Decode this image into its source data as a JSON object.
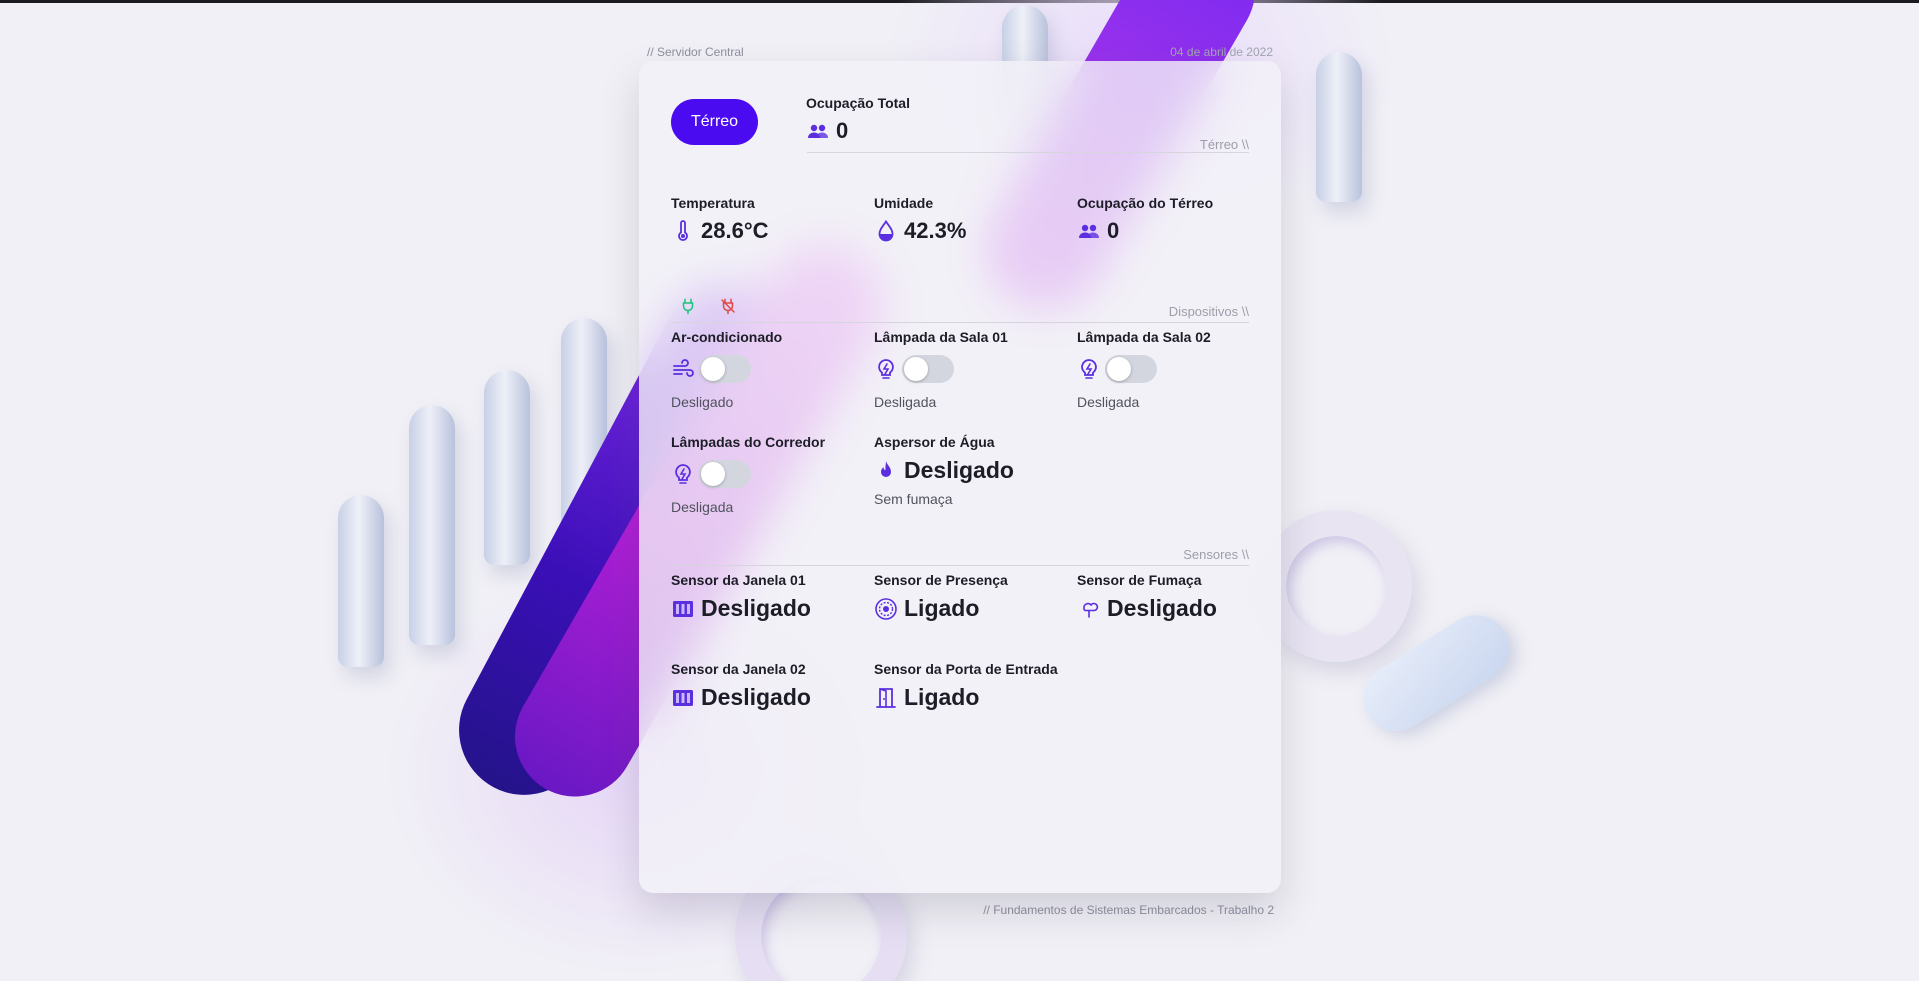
{
  "page": {
    "header_left": "// Servidor Central",
    "header_right": "04 de abril de 2022",
    "footer": "// Fundamentos de Sistemas Embarcados - Trabalho 2"
  },
  "floor": {
    "button_label": "Térreo",
    "total_occupancy_label": "Ocupação Total",
    "total_occupancy_value": "0",
    "section_label": "Térreo \\\\"
  },
  "climate": {
    "temperature_label": "Temperatura",
    "temperature_value": "28.6°C",
    "humidity_label": "Umidade",
    "humidity_value": "42.3%",
    "floor_occupancy_label": "Ocupação do Térreo",
    "floor_occupancy_value": "0"
  },
  "devices": {
    "section_label": "Dispositivos \\\\",
    "items": [
      {
        "label": "Ar-condicionado",
        "state": "Desligado",
        "on": false,
        "icon": "wind-icon"
      },
      {
        "label": "Lâmpada da Sala 01",
        "state": "Desligada",
        "on": false,
        "icon": "lightbulb-icon"
      },
      {
        "label": "Lâmpada da Sala 02",
        "state": "Desligada",
        "on": false,
        "icon": "lightbulb-icon"
      },
      {
        "label": "Lâmpadas do Corredor",
        "state": "Desligada",
        "on": false,
        "icon": "lightbulb-icon"
      }
    ],
    "sprinkler": {
      "label": "Aspersor de Água",
      "value": "Desligado",
      "sub": "Sem fumaça",
      "icon": "flame-icon"
    }
  },
  "sensors": {
    "section_label": "Sensores \\\\",
    "items": [
      {
        "label": "Sensor da Janela 01",
        "value": "Desligado",
        "icon": "window-icon"
      },
      {
        "label": "Sensor de Presença",
        "value": "Ligado",
        "icon": "presence-icon"
      },
      {
        "label": "Sensor de Fumaça",
        "value": "Desligado",
        "icon": "smoke-icon"
      },
      {
        "label": "Sensor da Janela 02",
        "value": "Desligado",
        "icon": "window-icon"
      },
      {
        "label": "Sensor da Porta de Entrada",
        "value": "Ligado",
        "icon": "door-icon"
      }
    ]
  },
  "colors": {
    "accent": "#4a0bf0",
    "icon": "#5b2fe0",
    "plug_on": "#19c37d",
    "plug_off": "#e04848"
  }
}
